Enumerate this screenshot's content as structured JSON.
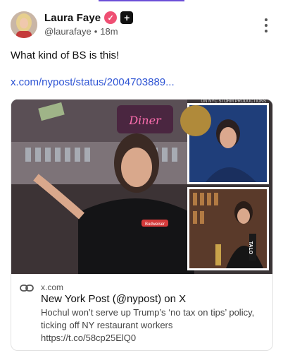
{
  "post": {
    "author": {
      "display_name": "Laura Faye",
      "handle": "@laurafaye",
      "separator": "•",
      "time": "18m",
      "verified_icon": "verified-check-icon",
      "plus_badge": "+"
    },
    "text": "What kind of BS is this!",
    "link": "x.com/nypost/status/2004703889..."
  },
  "card": {
    "image_caption_text": "ON NYC STORM PRODUCTIONS",
    "sign_text": "Diner",
    "shirt_text": "Budweiser",
    "tap_label": "TALO",
    "link_icon": "link-icon",
    "domain": "x.com",
    "title": "New York Post (@nypost) on X",
    "description": "Hochul won’t serve up Trump’s ‘no tax on tips’ policy, ticking off NY restaurant workers",
    "url": "https://t.co/58cp25ElQ0"
  },
  "colors": {
    "link": "#2f55d4",
    "verified": "#ef4f73",
    "accent": "#6b4fd8"
  }
}
